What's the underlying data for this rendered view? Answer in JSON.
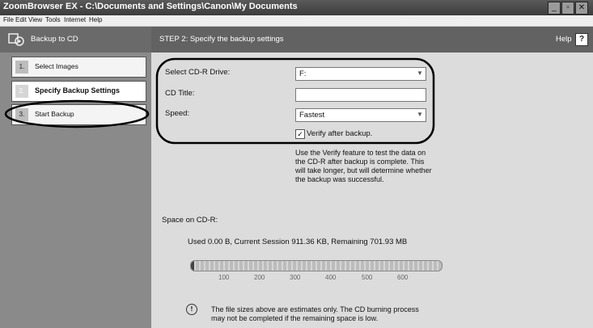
{
  "window": {
    "title": "ZoomBrowser EX - C:\\Documents and Settings\\Canon\\My Documents"
  },
  "menu": {
    "items": [
      "File",
      "Edit",
      "View",
      "Tools",
      "Internet",
      "Help"
    ]
  },
  "header": {
    "left_title": "Backup to CD",
    "step_title": "STEP 2: Specify the backup settings",
    "help_label": "Help"
  },
  "sidebar": {
    "steps": [
      {
        "num": "1.",
        "label": "Select Images"
      },
      {
        "num": "2.",
        "label": "Specify Backup Settings"
      },
      {
        "num": "3.",
        "label": "Start Backup"
      }
    ]
  },
  "form": {
    "drive_label": "Select CD-R Drive:",
    "drive_value": "F:",
    "title_label": "CD Title:",
    "title_value": "",
    "speed_label": "Speed:",
    "speed_value": "Fastest",
    "verify_label": "Verify after backup.",
    "verify_checked": true,
    "verify_help": [
      "Use the Verify feature to test the data on",
      "the CD-R after backup is complete. This",
      "will take longer, but will determine whether",
      "the backup was successful."
    ]
  },
  "space": {
    "label": "Space on CD-R:",
    "summary": "Used 0.00 B, Current Session 911.36 KB, Remaining 701.93 MB",
    "used_fraction": 0.005,
    "ticks": [
      "100",
      "200",
      "300",
      "400",
      "500",
      "600"
    ],
    "note_lines": [
      "The file sizes above are estimates only. The CD burning process",
      "may not be completed if the remaining space is low."
    ]
  }
}
